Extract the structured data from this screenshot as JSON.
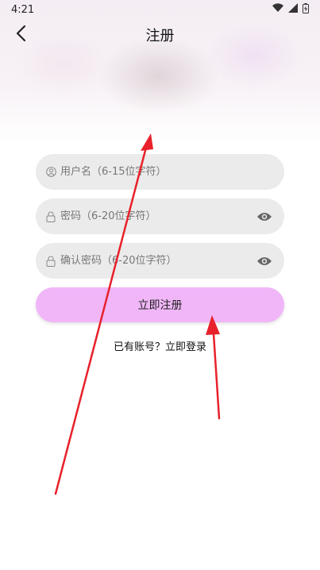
{
  "status_bar": {
    "time": "4:21"
  },
  "nav": {
    "title": "注册"
  },
  "form": {
    "username": {
      "placeholder": "用户名（6-15位字符）",
      "value": ""
    },
    "password": {
      "placeholder": "密码（6-20位字符）",
      "value": ""
    },
    "confirm_password": {
      "placeholder": "确认密码（6-20位字符）",
      "value": ""
    },
    "submit_label": "立即注册"
  },
  "footer": {
    "login_link": "已有账号？立即登录"
  },
  "colors": {
    "accent": "#f0b6f7",
    "field_bg": "#ebebeb",
    "annotation": "#e8212b"
  },
  "icons": [
    "chevron-left-icon",
    "wifi-icon",
    "signal-icon",
    "battery-icon",
    "user-icon",
    "lock-icon",
    "eye-icon"
  ]
}
